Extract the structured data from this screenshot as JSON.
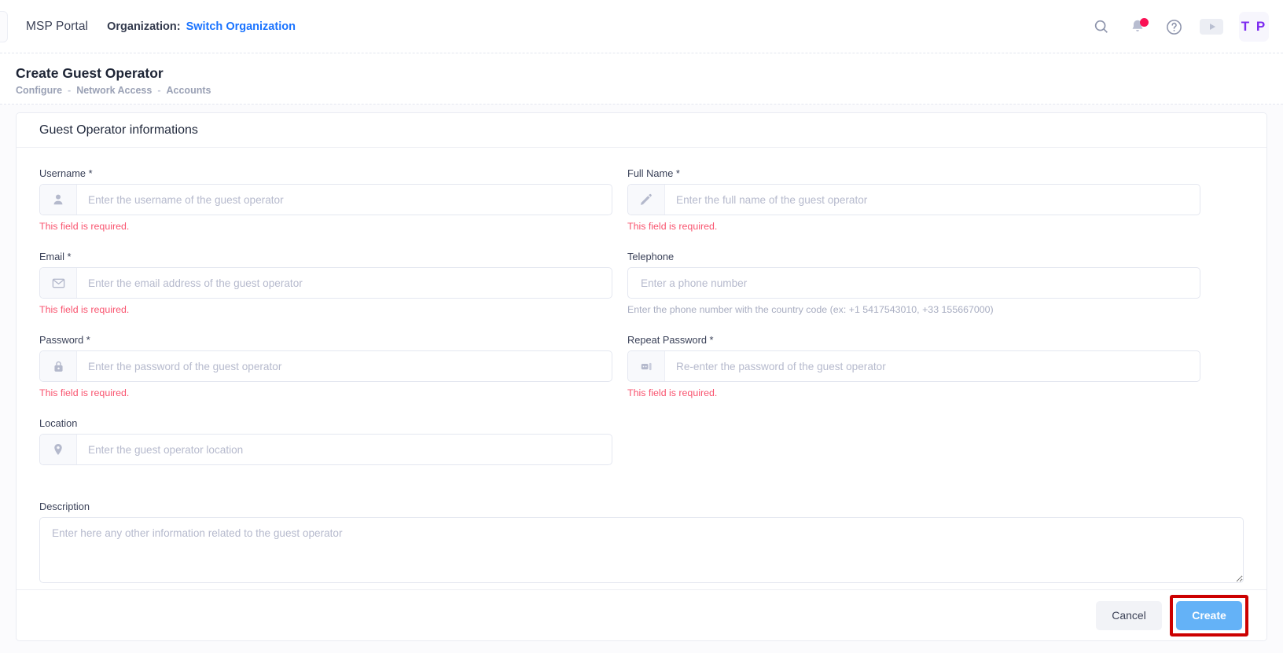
{
  "topbar": {
    "brand": "MSP Portal",
    "org_label": "Organization:",
    "org_link": "Switch Organization",
    "icons": {
      "search": "search-icon",
      "notifications": "bell-icon",
      "help": "question-circle-icon",
      "video": "play-icon"
    },
    "avatar_initials": "T P"
  },
  "page": {
    "title": "Create Guest Operator",
    "breadcrumbs": [
      "Configure",
      "Network Access",
      "Accounts"
    ],
    "breadcrumb_separator": "-"
  },
  "card": {
    "title": "Guest Operator informations",
    "fields": {
      "username": {
        "label": "Username *",
        "placeholder": "Enter the username of the guest operator",
        "value": "",
        "icon": "user-icon",
        "error": "This field is required."
      },
      "fullname": {
        "label": "Full Name *",
        "placeholder": "Enter the full name of the guest operator",
        "value": "",
        "icon": "pencil-icon",
        "error": "This field is required."
      },
      "email": {
        "label": "Email *",
        "placeholder": "Enter the email address of the guest operator",
        "value": "",
        "icon": "envelope-icon",
        "error": "This field is required."
      },
      "telephone": {
        "label": "Telephone",
        "placeholder": "Enter a phone number",
        "value": "",
        "hint": "Enter the phone number with the country code (ex: +1 5417543010, +33 155667000)"
      },
      "password": {
        "label": "Password *",
        "placeholder": "Enter the password of the guest operator",
        "value": "",
        "icon": "lock-icon",
        "error": "This field is required."
      },
      "repeat_password": {
        "label": "Repeat Password *",
        "placeholder": "Re-enter the password of the guest operator",
        "value": "",
        "icon": "lock-repeat-icon",
        "error": "This field is required."
      },
      "location": {
        "label": "Location",
        "placeholder": "Enter the guest operator location",
        "value": "",
        "icon": "map-pin-icon"
      },
      "description": {
        "label": "Description",
        "placeholder": "Enter here any other information related to the guest operator",
        "value": ""
      }
    },
    "footer": {
      "cancel_label": "Cancel",
      "create_label": "Create"
    }
  },
  "colors": {
    "accent_link": "#1a73ff",
    "primary_button": "#64b2f7",
    "error_text": "#f9546f",
    "badge": "#fa1155",
    "avatar_text": "#7d2bf0",
    "highlight_box": "#cc0000"
  }
}
